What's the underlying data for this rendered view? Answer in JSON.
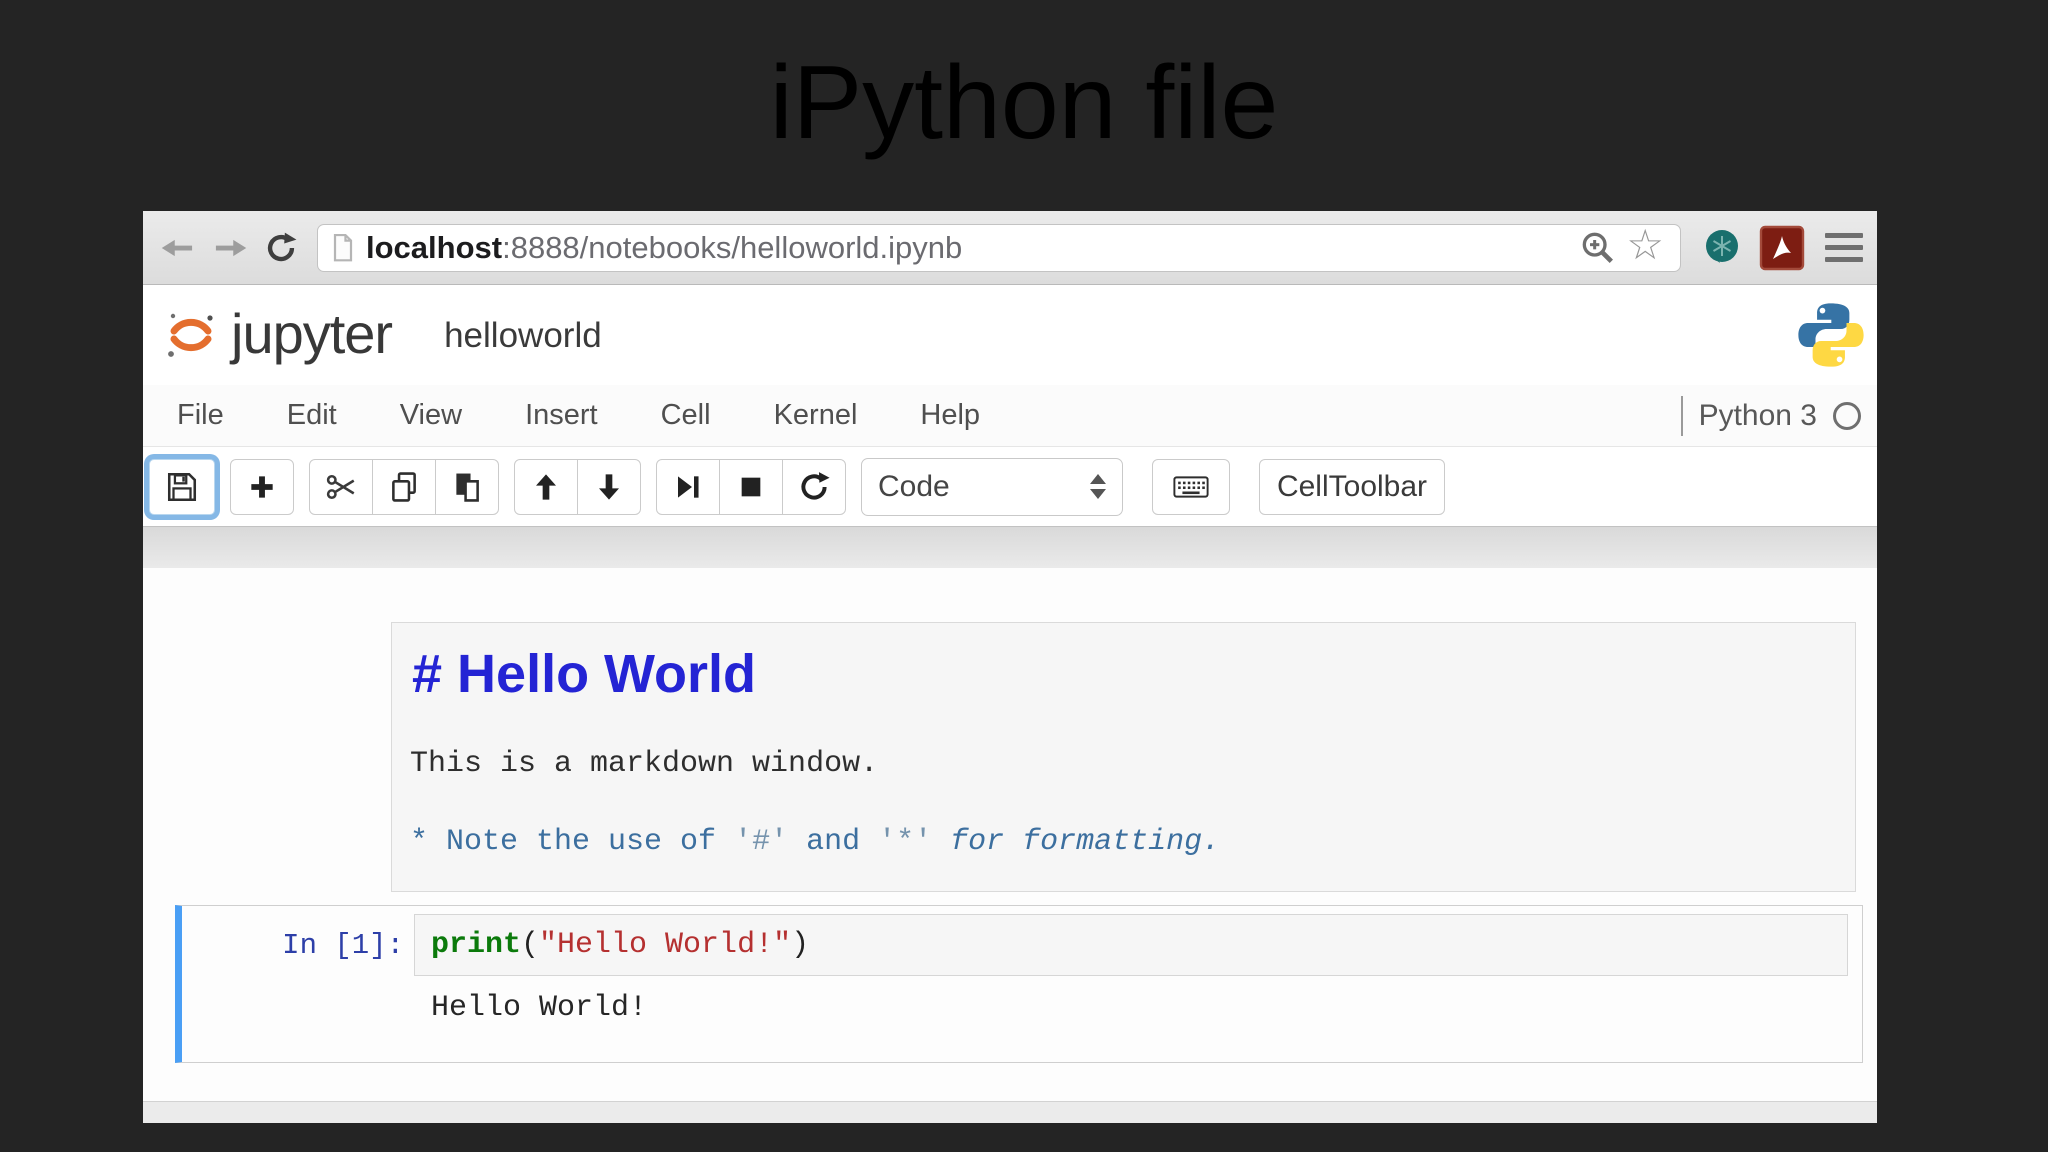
{
  "slide": {
    "title": "iPython file"
  },
  "browser_chrome": {
    "url": {
      "host": "localhost",
      "rest": ":8888/notebooks/helloworld.ipynb"
    },
    "icons": {
      "back": "back-arrow",
      "forward": "forward-arrow",
      "refresh": "circular-arrow",
      "page": "document-outline",
      "zoom": "magnifier-plus",
      "bookmark_glyph": "☆",
      "extension": "teal-snowflake-pin",
      "pdf": "adobe-acrobat",
      "menu": "hamburger"
    }
  },
  "header": {
    "brand": "jupyter",
    "notebook_title": "helloworld",
    "logo": "jupyter-planet",
    "python_logo": "python-two-snakes"
  },
  "menu": {
    "items": [
      "File",
      "Edit",
      "View",
      "Insert",
      "Cell",
      "Kernel",
      "Help"
    ],
    "kernel_name": "Python 3"
  },
  "toolbar": {
    "cell_type_value": "Code",
    "cell_toolbar_label": "CellToolbar",
    "buttons": [
      "save",
      "add-cell",
      "cut-cells",
      "copy-cells",
      "paste-cells",
      "move-up",
      "move-down",
      "run-cell",
      "stop-kernel",
      "restart-kernel",
      "keyboard"
    ]
  },
  "markdown_cell": {
    "heading": "# Hello World",
    "paragraph": "This is a markdown window.",
    "note": {
      "s1": "* Note the use of ",
      "q1": "'#'",
      "s2": " and ",
      "q2": "'*'",
      "s3": " ",
      "italic": "for formatting."
    }
  },
  "code_cell": {
    "prompt": "In [1]:",
    "tokens": {
      "fn": "print",
      "open": "(",
      "string": "\"Hello World!\"",
      "close": ")"
    },
    "output": "Hello World!"
  },
  "colors": {
    "slide_background": "#242424",
    "selected_cell_bar": "#4a9ff5",
    "heading_blue": "#2424d4",
    "note_blue": "#3c6f9f",
    "prompt_blue": "#2d3fa8",
    "keyword_green": "#0b7a0b",
    "string_red": "#b53030",
    "jupyter_orange": "#e46e2e",
    "save_focus_ring": "#85b8e6"
  }
}
